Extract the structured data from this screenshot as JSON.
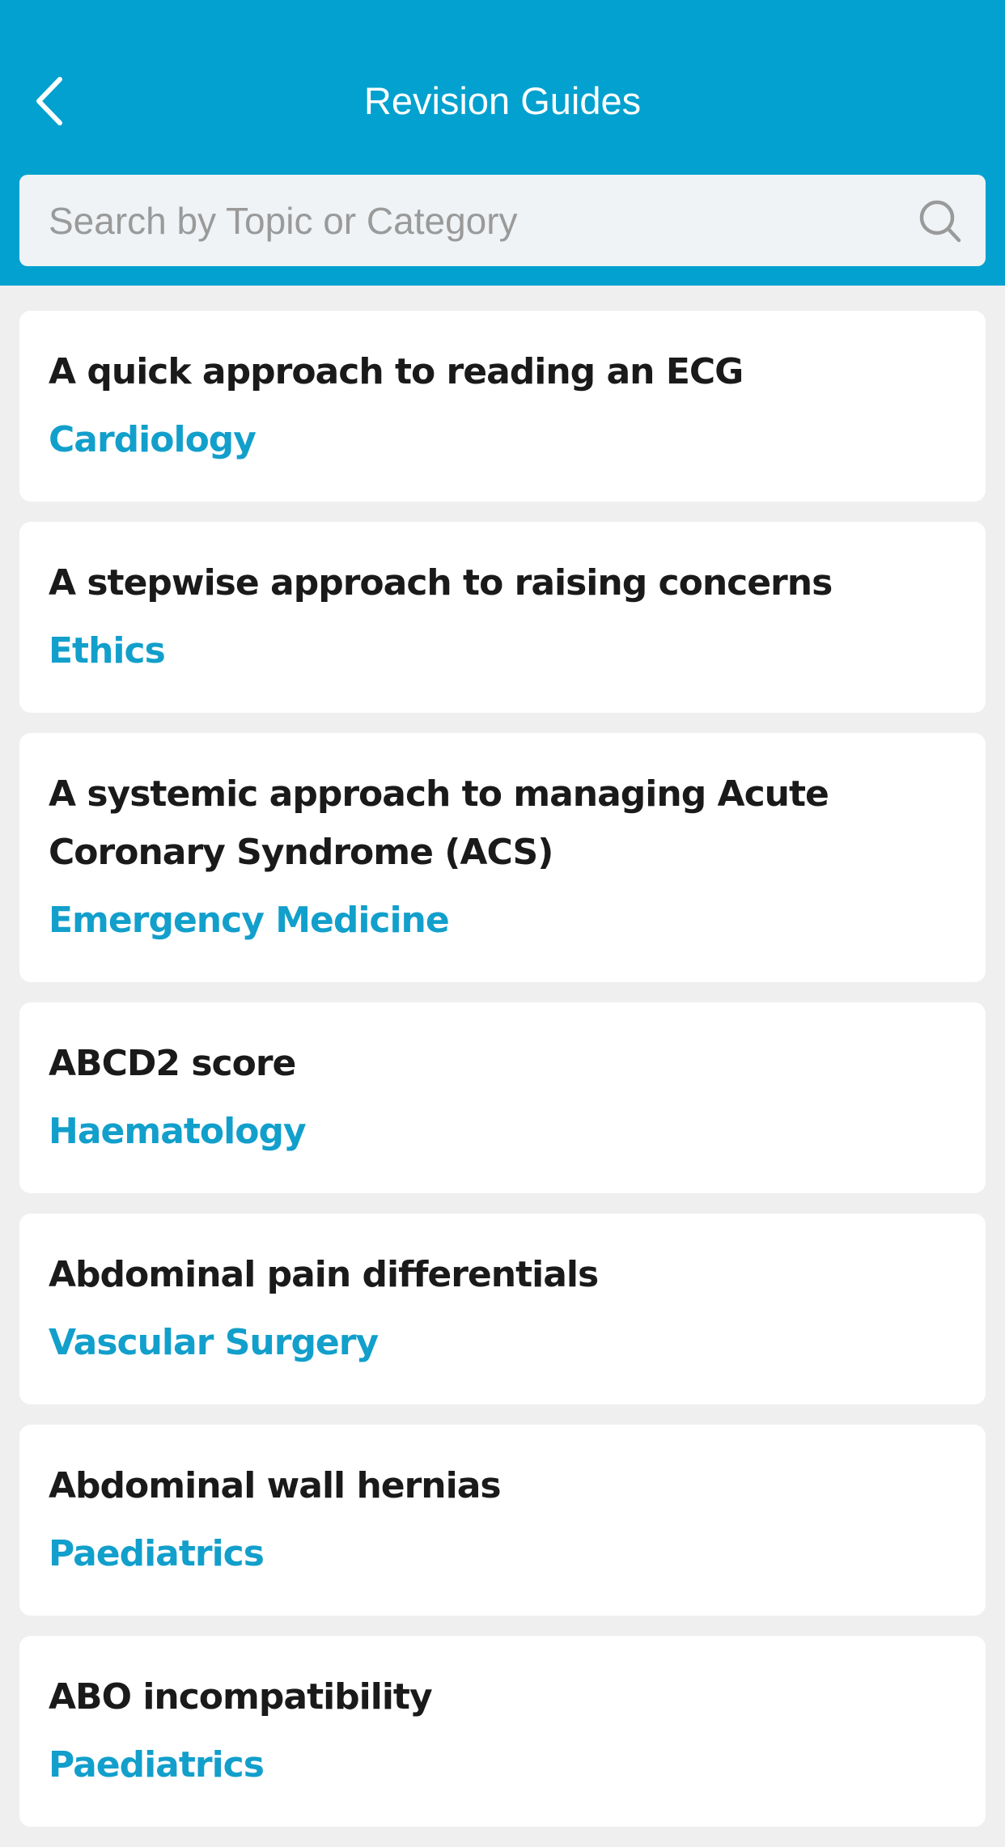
{
  "header": {
    "title": "Revision Guides",
    "back_icon": "chevron-left-icon",
    "background_color": "#02a1cf"
  },
  "search": {
    "placeholder": "Search by Topic or Category",
    "value": "",
    "icon": "search-icon"
  },
  "category_color": "#129fcb",
  "guides": [
    {
      "title": "A quick approach to reading an ECG",
      "category": "Cardiology"
    },
    {
      "title": "A stepwise approach to raising concerns",
      "category": "Ethics"
    },
    {
      "title": "A systemic approach to managing Acute Coronary Syndrome (ACS)",
      "category": "Emergency Medicine"
    },
    {
      "title": "ABCD2 score",
      "category": "Haematology"
    },
    {
      "title": "Abdominal pain differentials",
      "category": "Vascular Surgery"
    },
    {
      "title": "Abdominal wall hernias",
      "category": "Paediatrics"
    },
    {
      "title": "ABO incompatibility",
      "category": "Paediatrics"
    }
  ]
}
